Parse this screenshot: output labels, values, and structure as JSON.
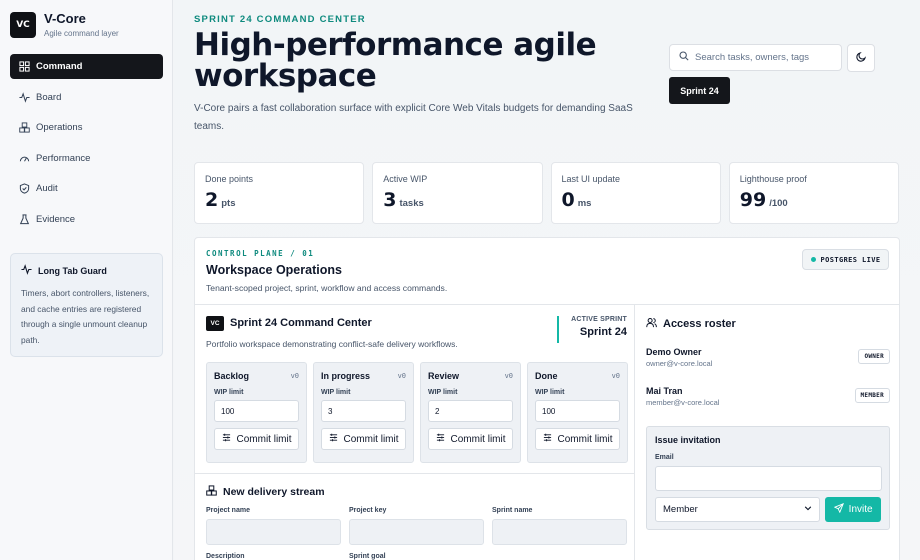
{
  "brand": {
    "logo": "VC",
    "name": "V-Core",
    "subtitle": "Agile command layer"
  },
  "sidebar": {
    "items": [
      {
        "label": "Command",
        "icon": "grid-icon",
        "active": true
      },
      {
        "label": "Board",
        "icon": "pulse-icon"
      },
      {
        "label": "Operations",
        "icon": "boxes-icon"
      },
      {
        "label": "Performance",
        "icon": "gauge-icon"
      },
      {
        "label": "Audit",
        "icon": "shield-icon"
      },
      {
        "label": "Evidence",
        "icon": "flask-icon"
      }
    ],
    "guard": {
      "title": "Long Tab Guard",
      "text": "Timers, abort controllers, listeners, and cache entries are registered through a single unmount cleanup path."
    }
  },
  "header": {
    "eyebrow": "SPRINT 24 COMMAND CENTER",
    "title": "High-performance agile workspace",
    "description": "V-Core pairs a fast collaboration surface with explicit Core Web Vitals budgets for demanding SaaS teams.",
    "search_placeholder": "Search tasks, owners, tags",
    "sprint_button": "Sprint 24"
  },
  "stats": [
    {
      "label": "Done points",
      "value": "2",
      "unit": "pts"
    },
    {
      "label": "Active WIP",
      "value": "3",
      "unit": "tasks"
    },
    {
      "label": "Last UI update",
      "value": "0",
      "unit": "ms"
    },
    {
      "label": "Lighthouse proof",
      "value": "99",
      "unit": "/100"
    }
  ],
  "control_plane": {
    "eyebrow": "CONTROL PLANE / 01",
    "title": "Workspace Operations",
    "description": "Tenant-scoped project, sprint, workflow and access commands.",
    "db_badge": "POSTGRES LIVE",
    "command_center": {
      "badge": "VC",
      "title": "Sprint 24 Command Center",
      "description": "Portfolio workspace demonstrating conflict-safe delivery workflows.",
      "active_sprint_label": "ACTIVE SPRINT",
      "active_sprint_value": "Sprint 24"
    },
    "lanes": [
      {
        "name": "Backlog",
        "version": "v0",
        "wip_label": "WIP limit",
        "wip": "100",
        "button": "Commit limit"
      },
      {
        "name": "In progress",
        "version": "v0",
        "wip_label": "WIP limit",
        "wip": "3",
        "button": "Commit limit"
      },
      {
        "name": "Review",
        "version": "v0",
        "wip_label": "WIP limit",
        "wip": "2",
        "button": "Commit limit"
      },
      {
        "name": "Done",
        "version": "v0",
        "wip_label": "WIP limit",
        "wip": "100",
        "button": "Commit limit"
      }
    ],
    "delivery_stream": {
      "title": "New delivery stream",
      "fields": [
        "Project name",
        "Project key",
        "Sprint name"
      ],
      "fields2": [
        "Description",
        "Sprint goal"
      ]
    },
    "roster": {
      "title": "Access roster",
      "members": [
        {
          "name": "Demo Owner",
          "email": "owner@v-core.local",
          "role": "OWNER"
        },
        {
          "name": "Mai Tran",
          "email": "member@v-core.local",
          "role": "MEMBER"
        }
      ],
      "invitation": {
        "title": "Issue invitation",
        "email_label": "Email",
        "role_value": "Member",
        "button": "Invite"
      }
    }
  },
  "colors": {
    "accent": "#14b8a6",
    "dark": "#14161b",
    "eyebrow": "#0e8a7e"
  }
}
